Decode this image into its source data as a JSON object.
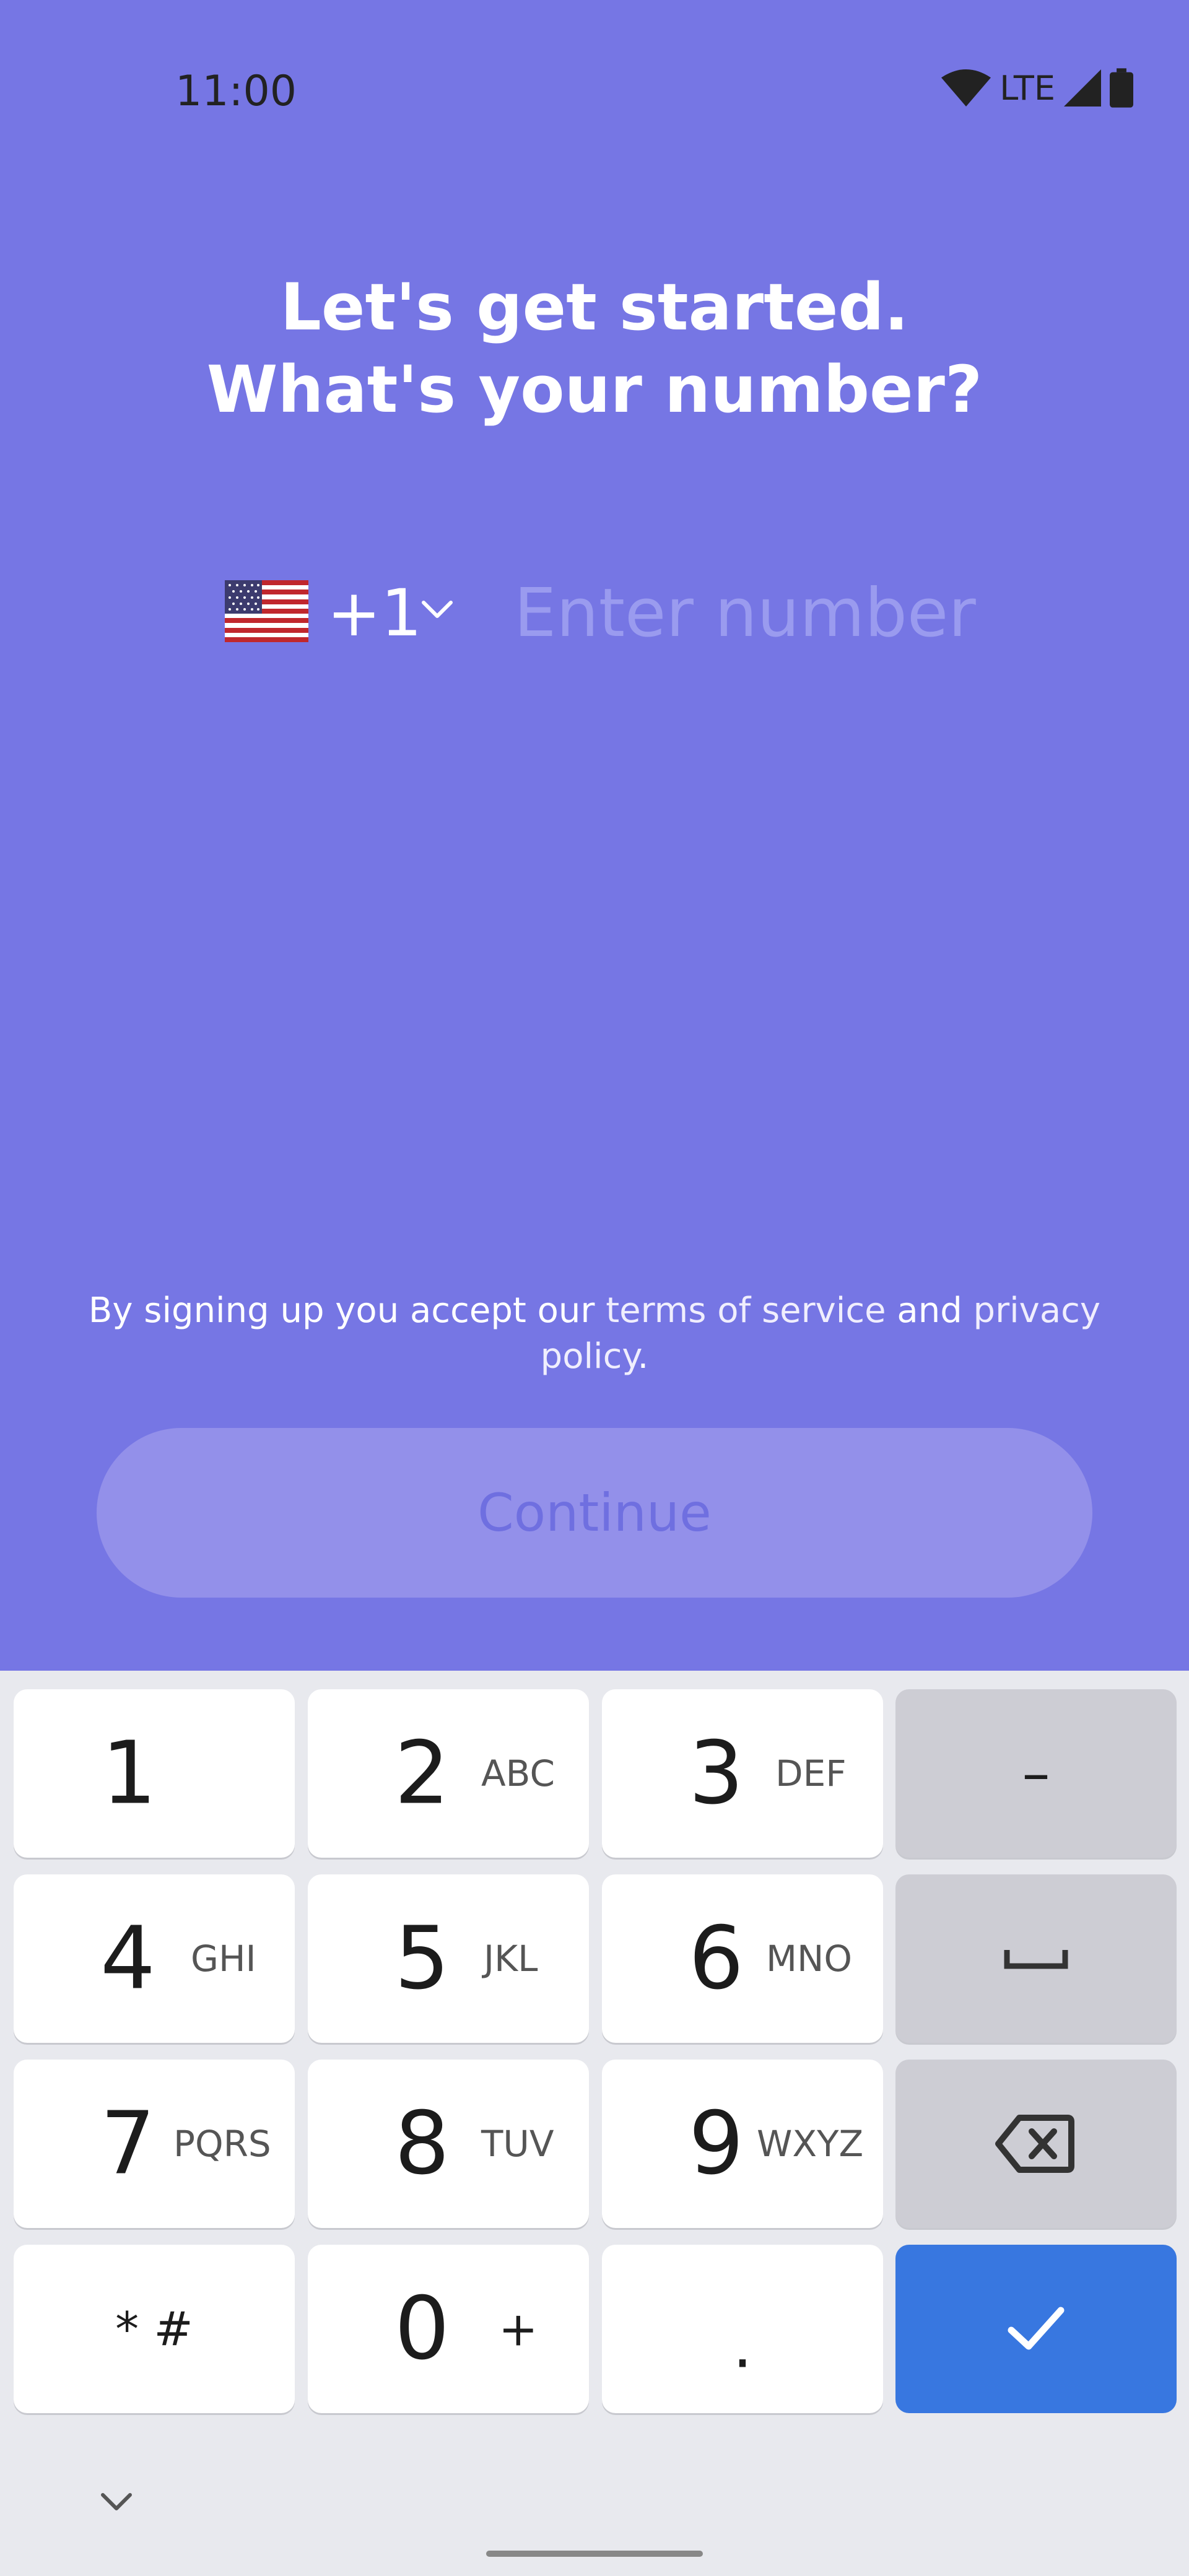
{
  "status_bar": {
    "time": "11:00",
    "network": "LTE",
    "icons": [
      "wifi-icon",
      "lte-text",
      "signal-icon",
      "battery-icon"
    ]
  },
  "title": {
    "line1": "Let's get started.",
    "line2": "What's your number?"
  },
  "phone": {
    "flag_icon": "us-flag-icon",
    "country_code": "+1",
    "value": "",
    "placeholder": "Enter number"
  },
  "legal": {
    "prefix": "By signing up you accept our ",
    "terms_link": "terms of service",
    "middle": " and ",
    "privacy_link": "privacy policy",
    "suffix": "."
  },
  "continue_label": "Continue",
  "keyboard": {
    "keys": [
      {
        "digit": "1",
        "letters": ""
      },
      {
        "digit": "2",
        "letters": "ABC"
      },
      {
        "digit": "3",
        "letters": "DEF"
      },
      {
        "digit": "4",
        "letters": "GHI"
      },
      {
        "digit": "5",
        "letters": "JKL"
      },
      {
        "digit": "6",
        "letters": "MNO"
      },
      {
        "digit": "7",
        "letters": "PQRS"
      },
      {
        "digit": "8",
        "letters": "TUV"
      },
      {
        "digit": "9",
        "letters": "WXYZ"
      },
      {
        "digit": "0",
        "letters": "+"
      }
    ],
    "star_hash": "* #",
    "period": ".",
    "dash": "–"
  },
  "colors": {
    "background": "#7676e4",
    "button_disabled": "#9390ea",
    "keyboard_bg": "#e8e9ee",
    "ok_key": "#3877e0"
  }
}
